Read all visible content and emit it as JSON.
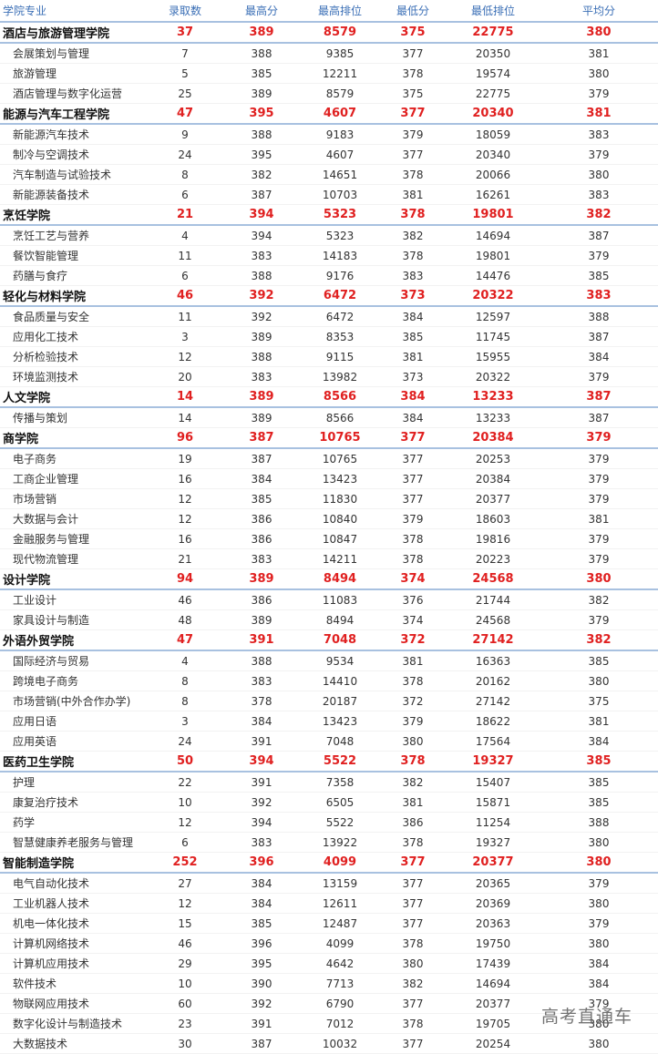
{
  "headers": [
    "学院专业",
    "录取数",
    "最高分",
    "最高排位",
    "最低分",
    "最低排位",
    "平均分"
  ],
  "watermark": "高考直通车",
  "rows": [
    {
      "type": "college",
      "cells": [
        "酒店与旅游管理学院",
        "37",
        "389",
        "8579",
        "375",
        "22775",
        "380"
      ]
    },
    {
      "type": "major",
      "cells": [
        "会展策划与管理",
        "7",
        "388",
        "9385",
        "377",
        "20350",
        "381"
      ]
    },
    {
      "type": "major",
      "cells": [
        "旅游管理",
        "5",
        "385",
        "12211",
        "378",
        "19574",
        "380"
      ]
    },
    {
      "type": "major",
      "cells": [
        "酒店管理与数字化运营",
        "25",
        "389",
        "8579",
        "375",
        "22775",
        "379"
      ]
    },
    {
      "type": "college",
      "cells": [
        "能源与汽车工程学院",
        "47",
        "395",
        "4607",
        "377",
        "20340",
        "381"
      ]
    },
    {
      "type": "major",
      "cells": [
        "新能源汽车技术",
        "9",
        "388",
        "9183",
        "379",
        "18059",
        "383"
      ]
    },
    {
      "type": "major",
      "cells": [
        "制冷与空调技术",
        "24",
        "395",
        "4607",
        "377",
        "20340",
        "379"
      ]
    },
    {
      "type": "major",
      "cells": [
        "汽车制造与试验技术",
        "8",
        "382",
        "14651",
        "378",
        "20066",
        "380"
      ]
    },
    {
      "type": "major",
      "cells": [
        "新能源装备技术",
        "6",
        "387",
        "10703",
        "381",
        "16261",
        "383"
      ]
    },
    {
      "type": "college",
      "cells": [
        "烹饪学院",
        "21",
        "394",
        "5323",
        "378",
        "19801",
        "382"
      ]
    },
    {
      "type": "major",
      "cells": [
        "烹饪工艺与营养",
        "4",
        "394",
        "5323",
        "382",
        "14694",
        "387"
      ]
    },
    {
      "type": "major",
      "cells": [
        "餐饮智能管理",
        "11",
        "383",
        "14183",
        "378",
        "19801",
        "379"
      ]
    },
    {
      "type": "major",
      "cells": [
        "药膳与食疗",
        "6",
        "388",
        "9176",
        "383",
        "14476",
        "385"
      ]
    },
    {
      "type": "college",
      "cells": [
        "轻化与材料学院",
        "46",
        "392",
        "6472",
        "373",
        "20322",
        "383"
      ]
    },
    {
      "type": "major",
      "cells": [
        "食品质量与安全",
        "11",
        "392",
        "6472",
        "384",
        "12597",
        "388"
      ]
    },
    {
      "type": "major",
      "cells": [
        "应用化工技术",
        "3",
        "389",
        "8353",
        "385",
        "11745",
        "387"
      ]
    },
    {
      "type": "major",
      "cells": [
        "分析检验技术",
        "12",
        "388",
        "9115",
        "381",
        "15955",
        "384"
      ]
    },
    {
      "type": "major",
      "cells": [
        "环境监测技术",
        "20",
        "383",
        "13982",
        "373",
        "20322",
        "379"
      ]
    },
    {
      "type": "college",
      "cells": [
        "人文学院",
        "14",
        "389",
        "8566",
        "384",
        "13233",
        "387"
      ]
    },
    {
      "type": "major",
      "cells": [
        "传播与策划",
        "14",
        "389",
        "8566",
        "384",
        "13233",
        "387"
      ]
    },
    {
      "type": "college",
      "cells": [
        "商学院",
        "96",
        "387",
        "10765",
        "377",
        "20384",
        "379"
      ]
    },
    {
      "type": "major",
      "cells": [
        "电子商务",
        "19",
        "387",
        "10765",
        "377",
        "20253",
        "379"
      ]
    },
    {
      "type": "major",
      "cells": [
        "工商企业管理",
        "16",
        "384",
        "13423",
        "377",
        "20384",
        "379"
      ]
    },
    {
      "type": "major",
      "cells": [
        "市场营销",
        "12",
        "385",
        "11830",
        "377",
        "20377",
        "379"
      ]
    },
    {
      "type": "major",
      "cells": [
        "大数据与会计",
        "12",
        "386",
        "10840",
        "379",
        "18603",
        "381"
      ]
    },
    {
      "type": "major",
      "cells": [
        "金融服务与管理",
        "16",
        "386",
        "10847",
        "378",
        "19816",
        "379"
      ]
    },
    {
      "type": "major",
      "cells": [
        "现代物流管理",
        "21",
        "383",
        "14211",
        "378",
        "20223",
        "379"
      ]
    },
    {
      "type": "college",
      "cells": [
        "设计学院",
        "94",
        "389",
        "8494",
        "374",
        "24568",
        "380"
      ]
    },
    {
      "type": "major",
      "cells": [
        "工业设计",
        "46",
        "386",
        "11083",
        "376",
        "21744",
        "382"
      ]
    },
    {
      "type": "major",
      "cells": [
        "家具设计与制造",
        "48",
        "389",
        "8494",
        "374",
        "24568",
        "379"
      ]
    },
    {
      "type": "college",
      "cells": [
        "外语外贸学院",
        "47",
        "391",
        "7048",
        "372",
        "27142",
        "382"
      ]
    },
    {
      "type": "major",
      "cells": [
        "国际经济与贸易",
        "4",
        "388",
        "9534",
        "381",
        "16363",
        "385"
      ]
    },
    {
      "type": "major",
      "cells": [
        "跨境电子商务",
        "8",
        "383",
        "14410",
        "378",
        "20162",
        "380"
      ]
    },
    {
      "type": "major",
      "cells": [
        "市场营销(中外合作办学)",
        "8",
        "378",
        "20187",
        "372",
        "27142",
        "375"
      ]
    },
    {
      "type": "major",
      "cells": [
        "应用日语",
        "3",
        "384",
        "13423",
        "379",
        "18622",
        "381"
      ]
    },
    {
      "type": "major",
      "cells": [
        "应用英语",
        "24",
        "391",
        "7048",
        "380",
        "17564",
        "384"
      ]
    },
    {
      "type": "college",
      "cells": [
        "医药卫生学院",
        "50",
        "394",
        "5522",
        "378",
        "19327",
        "385"
      ]
    },
    {
      "type": "major",
      "cells": [
        "护理",
        "22",
        "391",
        "7358",
        "382",
        "15407",
        "385"
      ]
    },
    {
      "type": "major",
      "cells": [
        "康复治疗技术",
        "10",
        "392",
        "6505",
        "381",
        "15871",
        "385"
      ]
    },
    {
      "type": "major",
      "cells": [
        "药学",
        "12",
        "394",
        "5522",
        "386",
        "11254",
        "388"
      ]
    },
    {
      "type": "major",
      "cells": [
        "智慧健康养老服务与管理",
        "6",
        "383",
        "13922",
        "378",
        "19327",
        "380"
      ]
    },
    {
      "type": "college",
      "cells": [
        "智能制造学院",
        "252",
        "396",
        "4099",
        "377",
        "20377",
        "380"
      ]
    },
    {
      "type": "major",
      "cells": [
        "电气自动化技术",
        "27",
        "384",
        "13159",
        "377",
        "20365",
        "379"
      ]
    },
    {
      "type": "major",
      "cells": [
        "工业机器人技术",
        "12",
        "384",
        "12611",
        "377",
        "20369",
        "380"
      ]
    },
    {
      "type": "major",
      "cells": [
        "机电一体化技术",
        "15",
        "385",
        "12487",
        "377",
        "20363",
        "379"
      ]
    },
    {
      "type": "major",
      "cells": [
        "计算机网络技术",
        "46",
        "396",
        "4099",
        "378",
        "19750",
        "380"
      ]
    },
    {
      "type": "major",
      "cells": [
        "计算机应用技术",
        "29",
        "395",
        "4642",
        "380",
        "17439",
        "384"
      ]
    },
    {
      "type": "major",
      "cells": [
        "软件技术",
        "10",
        "390",
        "7713",
        "382",
        "14694",
        "384"
      ]
    },
    {
      "type": "major",
      "cells": [
        "物联网应用技术",
        "60",
        "392",
        "6790",
        "377",
        "20377",
        "379"
      ]
    },
    {
      "type": "major",
      "cells": [
        "数字化设计与制造技术",
        "23",
        "391",
        "7012",
        "378",
        "19705",
        "380"
      ]
    },
    {
      "type": "major",
      "cells": [
        "大数据技术",
        "30",
        "387",
        "10032",
        "377",
        "20254",
        "380"
      ]
    }
  ]
}
